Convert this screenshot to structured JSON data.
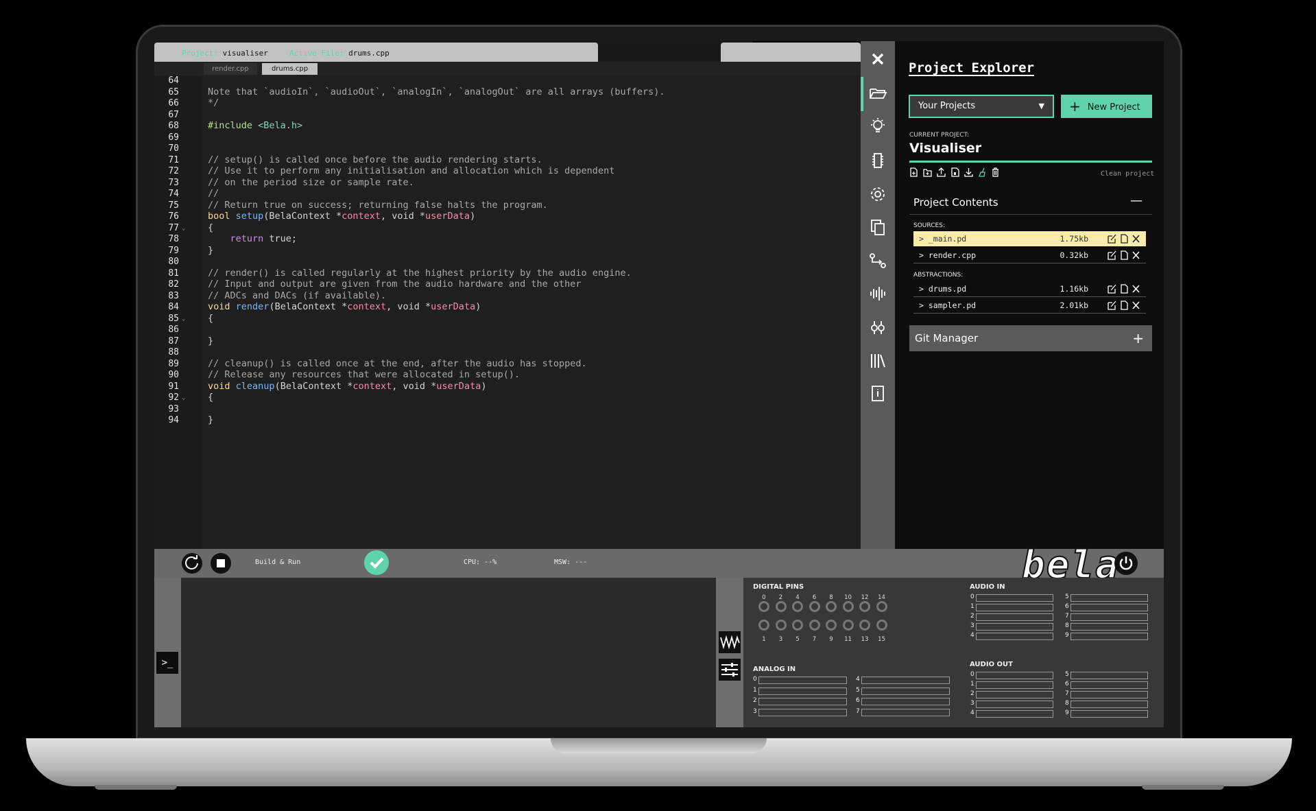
{
  "header": {
    "project_key": "Project:",
    "project_value": "visualiser",
    "active_key": "Active File:",
    "active_value": "drums.cpp"
  },
  "tabs": [
    {
      "label": "render.cpp"
    },
    {
      "label": "drums.cpp"
    }
  ],
  "code": {
    "line_numbers": [
      "64",
      "65",
      "66",
      "67",
      "68",
      "69",
      "70",
      "71",
      "72",
      "73",
      "74",
      "75",
      "76",
      "77",
      "78",
      "79",
      "80",
      "81",
      "82",
      "83",
      "84",
      "85",
      "86",
      "87",
      "88",
      "89",
      "90",
      "91",
      "92",
      "93",
      "94"
    ],
    "fold_lines": [
      "77",
      "85",
      "92"
    ],
    "l65": "Note that `audioIn`, `audioOut`, `analogIn`, `analogOut` are all arrays (buffers).",
    "l66": "*/",
    "l68_pp": "#include",
    "l68_h": " <Bela.h>",
    "l71": "// setup() is called once before the audio rendering starts.",
    "l72": "// Use it to perform any initialisation and allocation which is dependent",
    "l73": "// on the period size or sample rate.",
    "l74": "//",
    "l75": "// Return true on success; returning false halts the program.",
    "kw_bool": "bool",
    "fn_setup": "setup",
    "kw_void": "void",
    "fn_render": "render",
    "fn_cleanup": "cleanup",
    "ctx_type": "(BelaContext *",
    "ctx_var": "context",
    "comma_void": ", void *",
    "ud_var": "userData",
    "close_paren": ")",
    "brace_open": "{",
    "brace_close": "}",
    "return_kw": "return",
    "return_val": " true;",
    "l81": "// render() is called regularly at the highest priority by the audio engine.",
    "l82": "// Input and output are given from the audio hardware and the other",
    "l83": "// ADCs and DACs (if available).",
    "l89": "// cleanup() is called once at the end, after the audio has stopped.",
    "l90": "// Release any resources that were allocated in setup()."
  },
  "panel": {
    "title": "Project Explorer",
    "select_label": "Your Projects",
    "new_project": "New Project",
    "current_label": "CURRENT PROJECT:",
    "current_name": "Visualiser",
    "clean_project": "Clean project",
    "contents_title": "Project Contents",
    "contents_toggle": "—",
    "sources_label": "SOURCES:",
    "abstractions_label": "ABSTRACTIONS:",
    "sources": [
      {
        "name": "> _main.pd",
        "size": "1.75kb"
      },
      {
        "name": "> render.cpp",
        "size": "0.32kb"
      }
    ],
    "abstractions": [
      {
        "name": "> drums.pd",
        "size": "1.16kb"
      },
      {
        "name": "> sampler.pd",
        "size": "2.01kb"
      }
    ],
    "git_manager": "Git Manager",
    "git_toggle": "+"
  },
  "toolbar": {
    "build_run": "Build & Run",
    "cpu": "CPU: --%",
    "msw": "MSW: ---",
    "logo": "bela"
  },
  "console": {
    "prompt": ">_"
  },
  "pins": {
    "digital_title": "DIGITAL PINS",
    "digital_top": [
      "0",
      "2",
      "4",
      "6",
      "8",
      "10",
      "12",
      "14"
    ],
    "digital_bottom": [
      "1",
      "3",
      "5",
      "7",
      "9",
      "11",
      "13",
      "15"
    ],
    "analog_in_title": "ANALOG IN",
    "analog_in_left": [
      "0",
      "1",
      "2",
      "3"
    ],
    "analog_in_right": [
      "4",
      "5",
      "6",
      "7"
    ],
    "audio_in_title": "AUDIO IN",
    "audio_in_left": [
      "0",
      "1",
      "2",
      "3",
      "4"
    ],
    "audio_in_right": [
      "5",
      "6",
      "7",
      "8",
      "9"
    ],
    "audio_out_title": "AUDIO OUT",
    "audio_out_left": [
      "0",
      "1",
      "2",
      "3",
      "4"
    ],
    "audio_out_right": [
      "5",
      "6",
      "7",
      "8",
      "9"
    ]
  },
  "colors": {
    "accent": "#5fd4ac",
    "highlight_row": "#f7ecaa"
  }
}
